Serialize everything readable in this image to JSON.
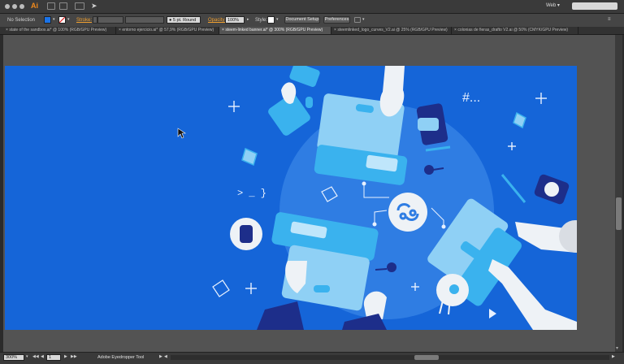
{
  "app": {
    "logo": "Ai",
    "workspace": "Web"
  },
  "control_bar": {
    "selection": "No Selection",
    "stroke_label": "Stroke:",
    "brush": "5 pt. Round",
    "opacity_label": "Opacity:",
    "opacity_value": "100%",
    "style_label": "Style:",
    "document_setup": "Document Setup",
    "preferences": "Preferences"
  },
  "tabs": [
    {
      "label": "state of the sandbox.ai* @ 100% (RGB/GPU Preview)"
    },
    {
      "label": "entorno ejercicio.ai* @ 57,9% (RGB/GPU Preview)"
    },
    {
      "label": "steem-linked banner.ai* @ 300% (RGB/GPU Preview)"
    },
    {
      "label": "steemlinked_logo_curves_V2.ai @ 25% (RGB/GPU Preview)"
    },
    {
      "label": "colonias de fieras_drafto V2.ai @ 50% (CMYK/GPU Preview)"
    }
  ],
  "status": {
    "zoom": "300%",
    "artboard": "1",
    "tool": "Adobe Eyedropper Tool"
  },
  "artwork": {
    "hashtag": "#...",
    "prompt": "> _ }"
  },
  "colors": {
    "artboard_bg": "#1565d8",
    "circle": "#2f7de3",
    "laptop_light": "#8fd0f5",
    "accent_cyan": "#3ab2ee",
    "navy": "#1d2e8a",
    "pale": "#eef2f6"
  }
}
